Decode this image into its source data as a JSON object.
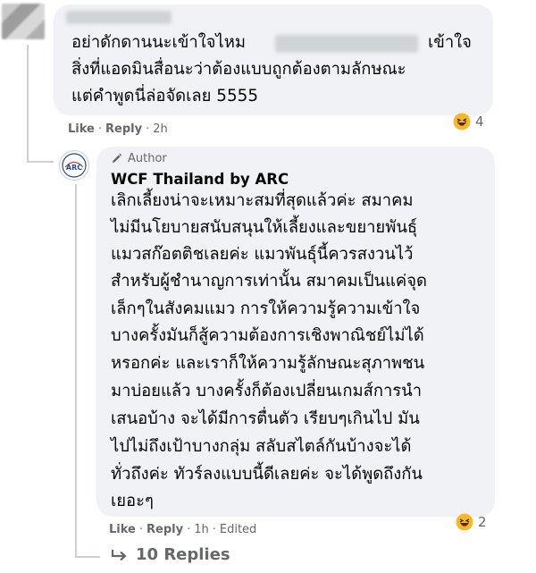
{
  "comment1": {
    "text_line1": "อย่าดักดานนะเข้าใจไหม",
    "text_line1_end": "เข้าใจ",
    "text_line2": "สิ่งที่แอดมินสื่อนะว่าต้องแบบถูกต้องตามลักษณะ",
    "text_line3": "แต่คำพูดนี่ล่อจัดเลย 5555",
    "like": "Like",
    "reply": "Reply",
    "time": "2h",
    "reaction_count": "4"
  },
  "comment2": {
    "badge": "Author",
    "author": "WCF Thailand by ARC",
    "avatar_text": "ARC",
    "lines": [
      "เลิกเลี้ยงน่าจะเหมาะสมที่สุดแล้วค่ะ สมาคม",
      "ไม่มีนโยบายสนับสนุนให้เลี้ยงและขยายพันธุ์",
      "แมวสก๊อตติชเลยค่ะ แมวพันธุ์นี้ควรสงวนไว้",
      "สำหรับผู้ชำนาญการเท่านั้น สมาคมเป็นแค่จุด",
      "เล็กๆในสังคมแมว การให้ความรู้ความเข้าใจ",
      "บางครั้งมันก็สู้ความต้องการเชิงพาณิชย์ไม่ได้",
      "หรอกค่ะ และเราก็ให้ความรู้ลักษณะสุภาพชน",
      "มาบ่อยแล้ว บางครั้งก็ต้องเปลี่ยนเกมส์การนำ",
      "เสนอบ้าง จะได้มีการตื่นตัว เรียบๆเกินไป มัน",
      "ไปไม่ถึงเป้าบางกลุ่ม สลับสไตล์กันบ้างจะได้",
      "ทั่วถึงค่ะ ทัวร์ลงแบบนี้ดีเลยค่ะ จะได้พูดถึงกัน",
      "เยอะๆ"
    ],
    "like": "Like",
    "reply": "Reply",
    "time": "1h",
    "edited": "Edited",
    "reaction_count": "2"
  },
  "replies": {
    "label": "10 Replies"
  },
  "colors": {
    "bubble": "#f0f2f5",
    "meta": "#65676b",
    "text": "#050505"
  }
}
